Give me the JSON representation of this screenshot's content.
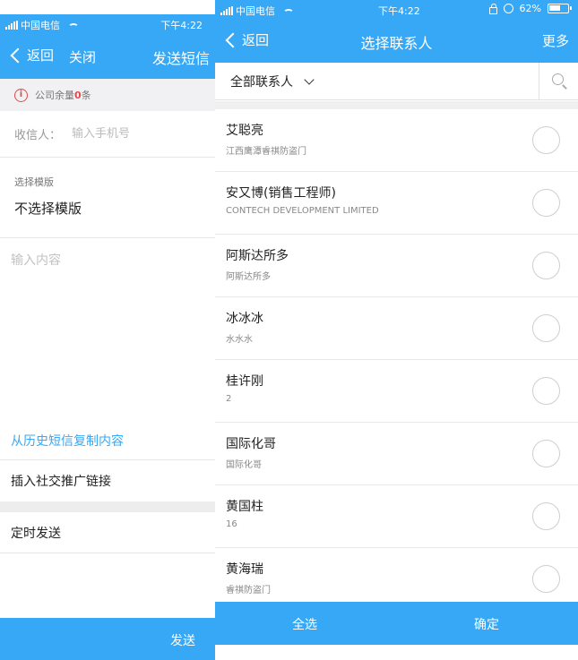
{
  "left": {
    "status": {
      "carrier": "中国电信",
      "time": "下午4:22"
    },
    "nav": {
      "back_label": "返回",
      "close_label": "关闭",
      "send_sms_label": "发送短信"
    },
    "quota": {
      "label": "公司余量",
      "count": "0",
      "unit": "条"
    },
    "recipient": {
      "label": "收信人：",
      "placeholder": "输入手机号",
      "value": ""
    },
    "template": {
      "caption": "选择模版",
      "value": "不选择模版"
    },
    "content": {
      "placeholder": "输入内容",
      "value": ""
    },
    "actions": {
      "copy_history": "从历史短信复制内容",
      "insert_social_link": "插入社交推广链接",
      "timed_send": "定时发送"
    },
    "send_label": "发送"
  },
  "right": {
    "status": {
      "carrier": "中国电信",
      "time": "下午4:22",
      "battery": "62%"
    },
    "nav": {
      "back_label": "返回",
      "title": "选择联系人",
      "more_label": "更多"
    },
    "filter": {
      "selected": "全部联系人"
    },
    "contacts": [
      {
        "name": "艾聪亮",
        "sub": "江西鹰潭睿祺防盗门",
        "selected": false
      },
      {
        "name": "安又博(销售工程师)",
        "sub": "CONTECH DEVELOPMENT LIMITED",
        "selected": false
      },
      {
        "name": "阿斯达所多",
        "sub": "阿斯达所多",
        "selected": false
      },
      {
        "name": "冰冰冰",
        "sub": "水水水",
        "selected": false
      },
      {
        "name": "桂许刚",
        "sub": "2",
        "selected": false
      },
      {
        "name": "国际化哥",
        "sub": "国际化哥",
        "selected": false
      },
      {
        "name": "黄国柱",
        "sub": "16",
        "selected": false
      },
      {
        "name": "黄海瑞",
        "sub": "睿祺防盗门",
        "selected": false
      }
    ],
    "bottom": {
      "select_all": "全选",
      "confirm": "确定"
    }
  },
  "colors": {
    "accent": "#36a8f5",
    "warning": "#e04a4a"
  }
}
